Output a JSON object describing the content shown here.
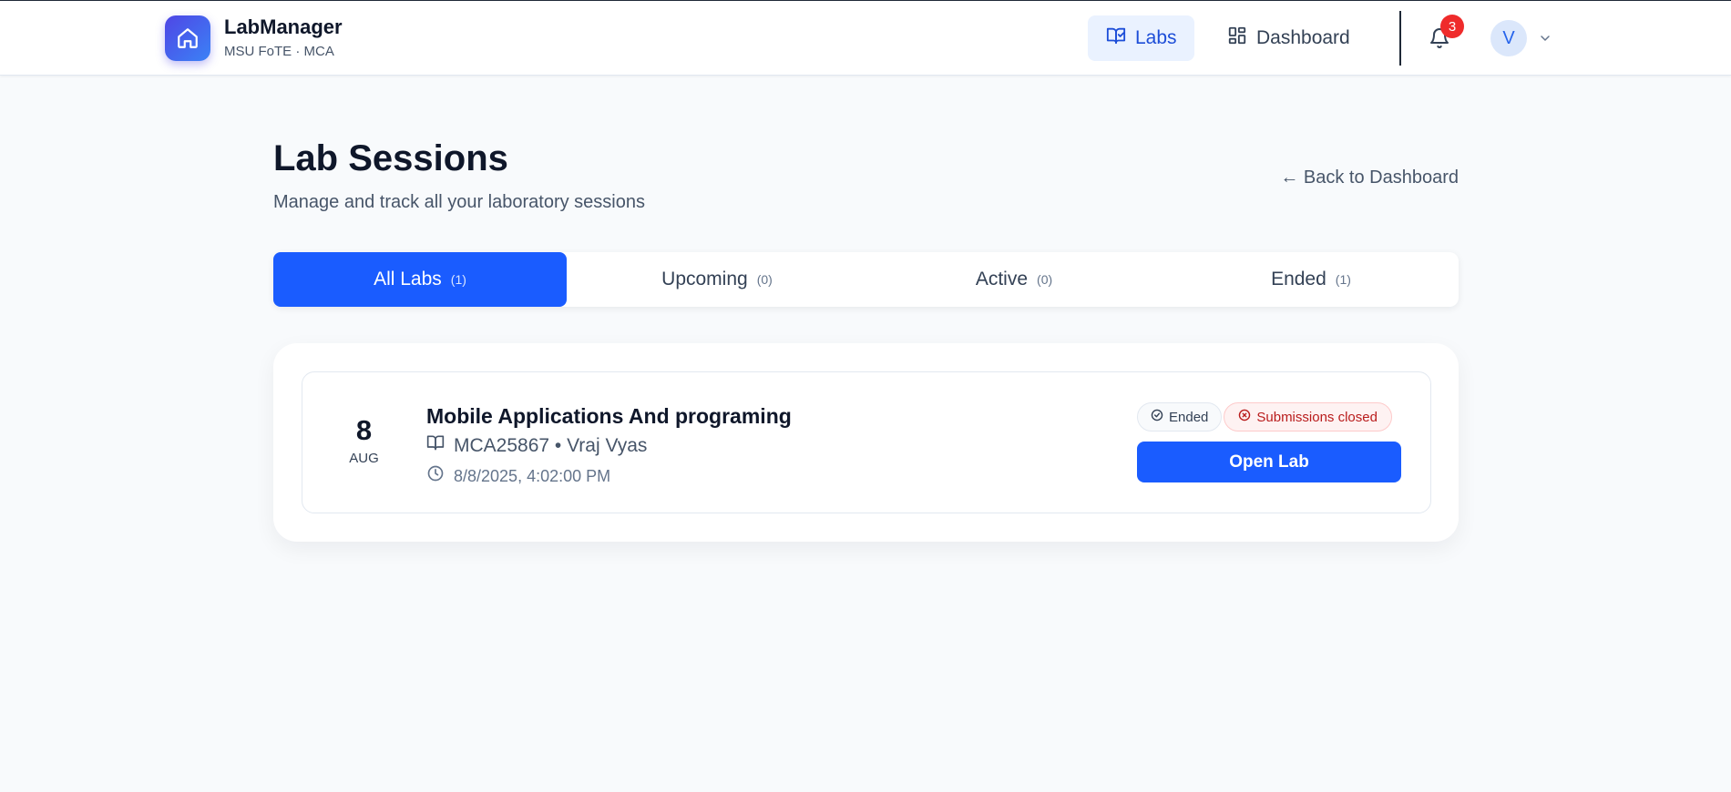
{
  "header": {
    "brand_name": "LabManager",
    "brand_sub": "MSU FoTE · MCA",
    "nav": [
      {
        "label": "Labs",
        "icon": "book-check-icon",
        "active": true
      },
      {
        "label": "Dashboard",
        "icon": "grid-icon",
        "active": false
      }
    ],
    "notifications_count": "3",
    "avatar_initial": "V"
  },
  "page": {
    "title": "Lab Sessions",
    "subtitle": "Manage and track all your laboratory sessions",
    "back_link": "← Back to Dashboard"
  },
  "tabs": [
    {
      "label": "All Labs",
      "count": "(1)",
      "active": true
    },
    {
      "label": "Upcoming",
      "count": "(0)",
      "active": false
    },
    {
      "label": "Active",
      "count": "(0)",
      "active": false
    },
    {
      "label": "Ended",
      "count": "(1)",
      "active": false
    }
  ],
  "labs": [
    {
      "day": "8",
      "month": "AUG",
      "title": "Mobile Applications And programing",
      "meta": "MCA25867 • Vraj Vyas",
      "datetime": "8/8/2025, 4:02:00 PM",
      "status_badge": "Ended",
      "submission_badge": "Submissions closed",
      "action_label": "Open Lab"
    }
  ],
  "colors": {
    "primary": "#1a5cff",
    "badge_red": "#b91c1c",
    "notification": "#ef2b2b"
  }
}
